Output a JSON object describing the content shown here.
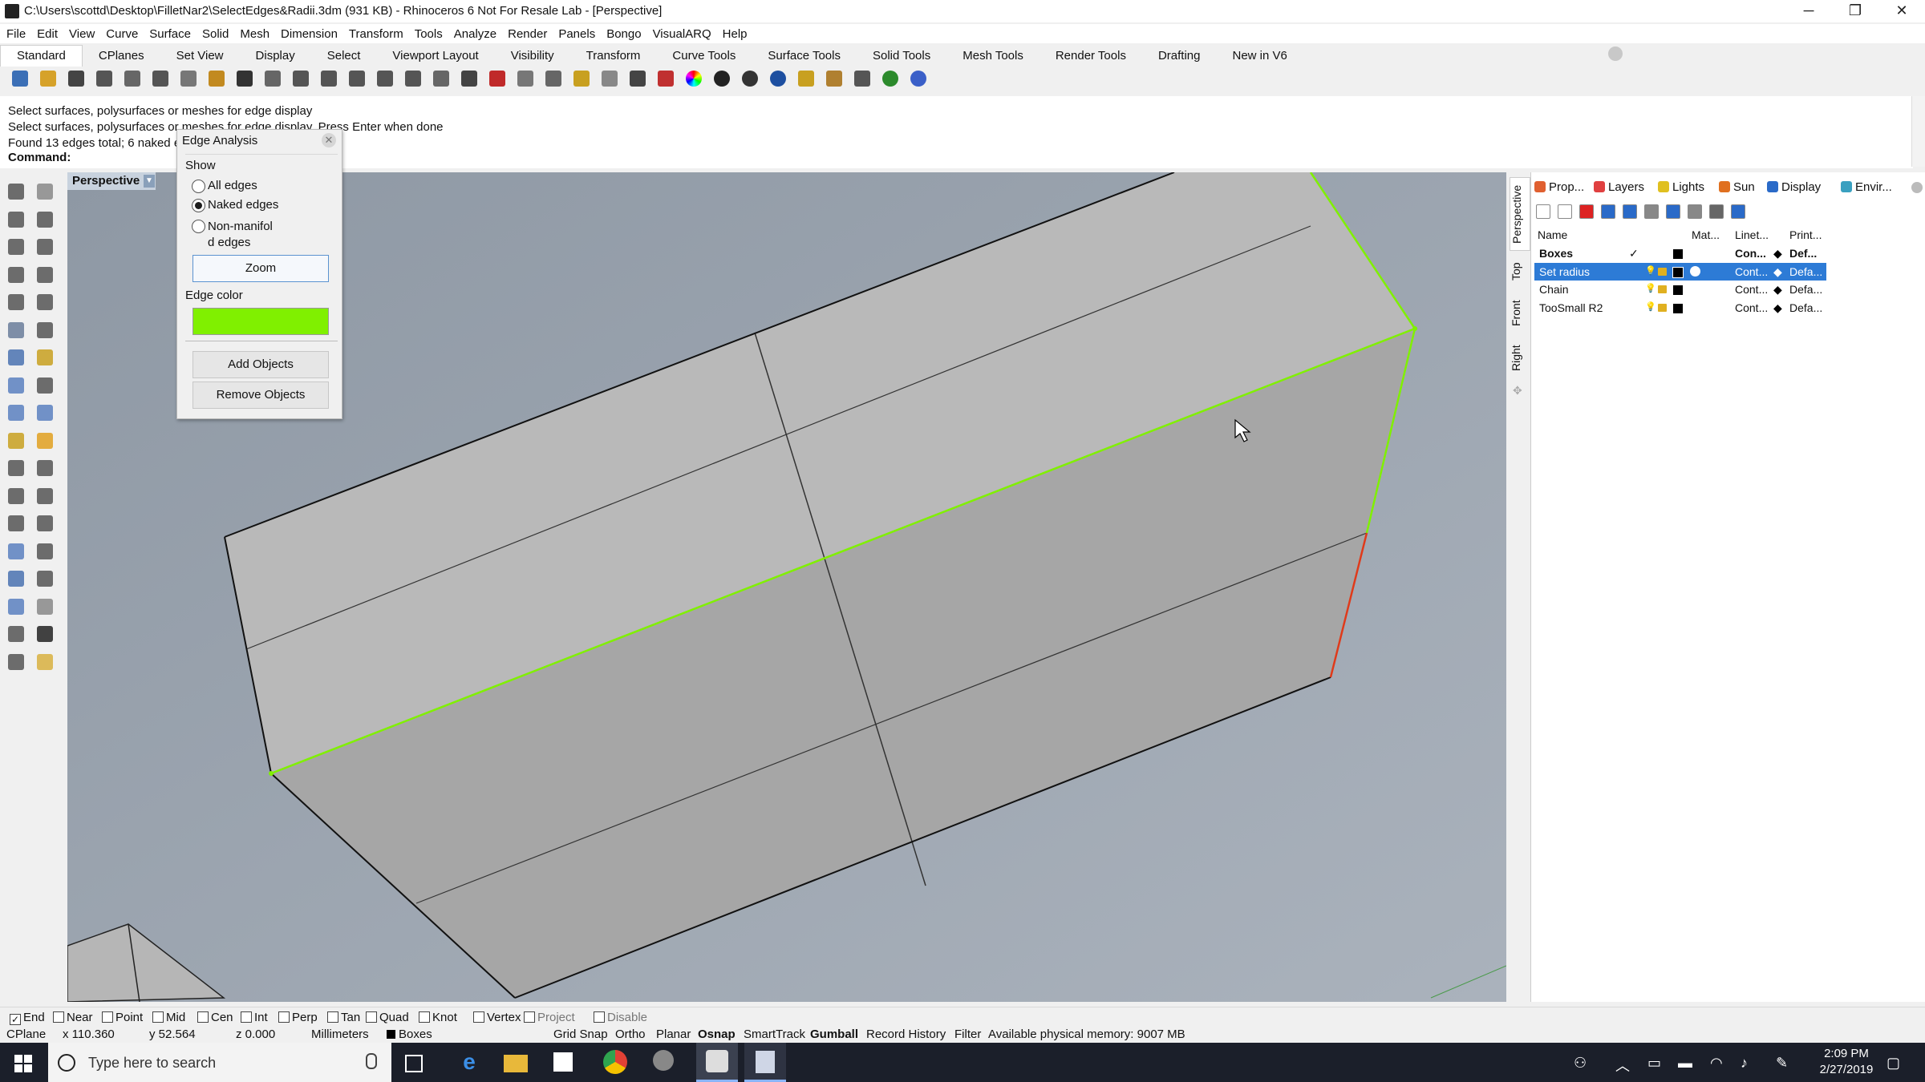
{
  "titlebar": {
    "title": "C:\\Users\\scottd\\Desktop\\FilletNar2\\SelectEdges&Radii.3dm (931 KB) - Rhinoceros 6 Not For Resale Lab - [Perspective]",
    "minimize_glyph": "─",
    "restore_glyph": "❐",
    "close_glyph": "✕"
  },
  "menu": [
    "File",
    "Edit",
    "View",
    "Curve",
    "Surface",
    "Solid",
    "Mesh",
    "Dimension",
    "Transform",
    "Tools",
    "Analyze",
    "Render",
    "Panels",
    "Bongo",
    "VisualARQ",
    "Help"
  ],
  "toolbar_tabs": [
    "Standard",
    "CPlanes",
    "Set View",
    "Display",
    "Select",
    "Viewport Layout",
    "Visibility",
    "Transform",
    "Curve Tools",
    "Surface Tools",
    "Solid Tools",
    "Mesh Tools",
    "Render Tools",
    "Drafting",
    "New in V6"
  ],
  "toolbar_icons": [
    "new-icon",
    "open-icon",
    "save-icon",
    "print-icon",
    "import-icon",
    "cut-icon",
    "copy-icon",
    "paste-icon",
    "undo-icon",
    "pan-icon",
    "rotate-view-icon",
    "zoom-icon",
    "zoom-window-icon",
    "zoom-extents-icon",
    "zoom-selected-icon",
    "rotate-icon",
    "grid-icon",
    "cplane-icon",
    "osnap-icon",
    "curve-icon",
    "filter-icon",
    "light-icon",
    "lock-icon",
    "layer-icon",
    "color-wheel-icon",
    "shaded-sphere-icon",
    "dark-sphere-icon",
    "render-sphere-icon",
    "select-filter-icon",
    "settings-gear-icon",
    "dimension-icon",
    "globe-icon",
    "help-icon"
  ],
  "command": {
    "history": [
      "Select surfaces, polysurfaces or meshes for edge display",
      "Select surfaces, polysurfaces or meshes for edge display. Press Enter when done",
      "Found 13 edges total; 6 naked e"
    ],
    "label": "Command:"
  },
  "viewport": {
    "title": "Perspective"
  },
  "dialog": {
    "title": "Edge Analysis",
    "show_label": "Show",
    "options": [
      "All edges",
      "Naked edges",
      "Non-manifol\nd edges"
    ],
    "selected_option": 1,
    "zoom_label": "Zoom",
    "edge_color_label": "Edge color",
    "edge_color": "#80f000",
    "add_label": "Add Objects",
    "remove_label": "Remove Objects"
  },
  "side_tabs": [
    "Perspective",
    "Top",
    "Front",
    "Right"
  ],
  "panel": {
    "tabs": [
      {
        "label": "Prop...",
        "icon": "properties-icon",
        "color": "#e06030"
      },
      {
        "label": "Layers",
        "icon": "layers-icon",
        "color": "#e04040"
      },
      {
        "label": "Lights",
        "icon": "lightbulb-icon",
        "color": "#e0c020"
      },
      {
        "label": "Sun",
        "icon": "sun-icon",
        "color": "#e07020"
      },
      {
        "label": "Display",
        "icon": "display-icon",
        "color": "#2a6ac8"
      },
      {
        "label": "Envir...",
        "icon": "environment-icon",
        "color": "#3aa0c0"
      }
    ],
    "columns": [
      "Name",
      "Mat...",
      "Linet...",
      "Print..."
    ],
    "layers": [
      {
        "name": "Boxes",
        "current": "✓",
        "linetype": "Con...",
        "print": "Def...",
        "bold": true,
        "selected": false,
        "color": "#000000"
      },
      {
        "name": "Set radius",
        "current": "",
        "linetype": "Cont...",
        "print": "Defa...",
        "bold": false,
        "selected": true,
        "color": "#000000"
      },
      {
        "name": "Chain",
        "current": "",
        "linetype": "Cont...",
        "print": "Defa...",
        "bold": false,
        "selected": false,
        "color": "#000000"
      },
      {
        "name": "TooSmall R2",
        "current": "",
        "linetype": "Cont...",
        "print": "Defa...",
        "bold": false,
        "selected": false,
        "color": "#000000"
      }
    ]
  },
  "osnap": [
    {
      "label": "End",
      "checked": true
    },
    {
      "label": "Near",
      "checked": false
    },
    {
      "label": "Point",
      "checked": false
    },
    {
      "label": "Mid",
      "checked": false
    },
    {
      "label": "Cen",
      "checked": false
    },
    {
      "label": "Int",
      "checked": false
    },
    {
      "label": "Perp",
      "checked": false
    },
    {
      "label": "Tan",
      "checked": false
    },
    {
      "label": "Quad",
      "checked": false
    },
    {
      "label": "Knot",
      "checked": false
    },
    {
      "label": "Vertex",
      "checked": false
    },
    {
      "label": "Project",
      "checked": false,
      "disabled": true
    },
    {
      "label": "Disable",
      "checked": false,
      "disabled": true
    }
  ],
  "status": {
    "cplane": "CPlane",
    "x": "x 110.360",
    "y": "y 52.564",
    "z": "z 0.000",
    "units": "Millimeters",
    "layer": "Boxes",
    "items": [
      "Grid Snap",
      "Ortho",
      "Planar",
      "Osnap",
      "SmartTrack",
      "Gumball",
      "Record History",
      "Filter"
    ],
    "bold_items": [
      "Osnap",
      "Gumball"
    ],
    "memory": "Available physical memory: 9007 MB"
  },
  "taskbar": {
    "search_placeholder": "Type here to search",
    "time": "2:09 PM",
    "date": "2/27/2019"
  }
}
